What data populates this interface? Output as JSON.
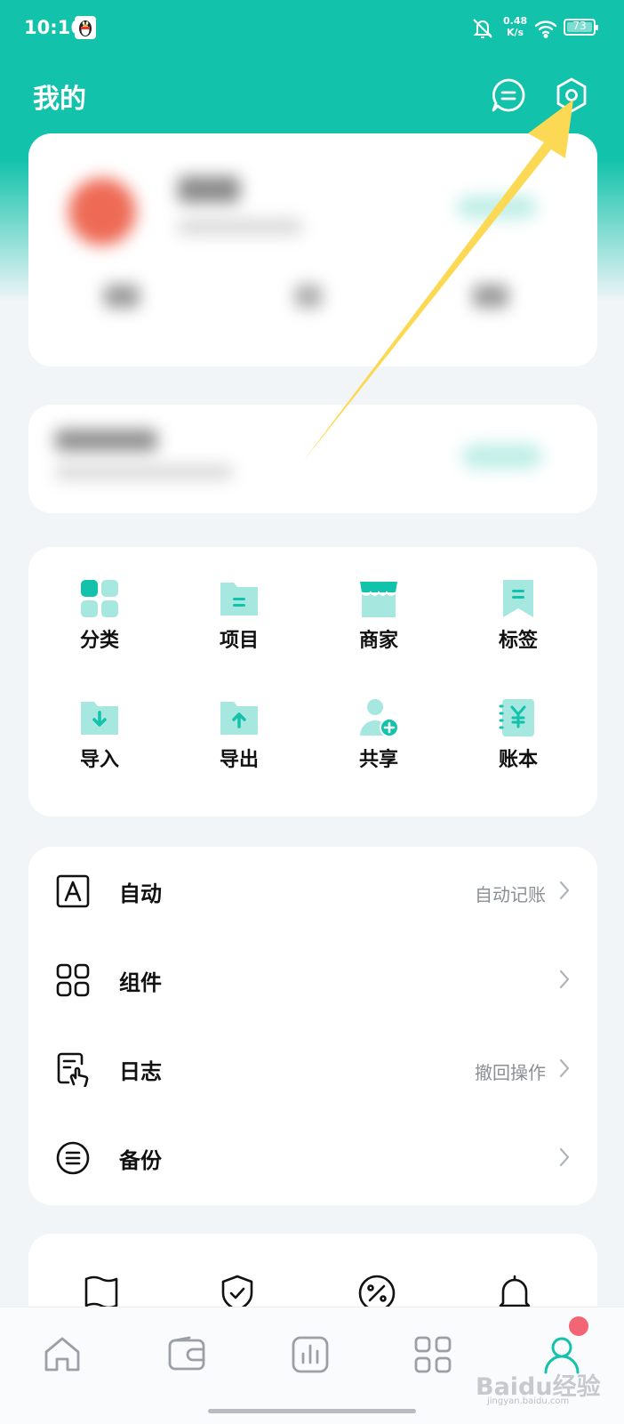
{
  "status_bar": {
    "time": "10:16",
    "net_speed_value": "0.48",
    "net_speed_unit": "K/s",
    "battery": "73"
  },
  "header": {
    "title": "我的"
  },
  "grid": [
    {
      "label": "分类",
      "icon": "category-icon"
    },
    {
      "label": "项目",
      "icon": "project-folder-icon"
    },
    {
      "label": "商家",
      "icon": "store-icon"
    },
    {
      "label": "标签",
      "icon": "bookmark-tag-icon"
    },
    {
      "label": "导入",
      "icon": "import-folder-icon"
    },
    {
      "label": "导出",
      "icon": "export-folder-icon"
    },
    {
      "label": "共享",
      "icon": "share-user-icon"
    },
    {
      "label": "账本",
      "icon": "ledger-book-icon"
    }
  ],
  "menu": [
    {
      "label": "自动",
      "value": "自动记账",
      "icon": "auto-a-icon"
    },
    {
      "label": "组件",
      "value": "",
      "icon": "widgets-grid-icon"
    },
    {
      "label": "日志",
      "value": "撤回操作",
      "icon": "log-touch-icon"
    },
    {
      "label": "备份",
      "value": "",
      "icon": "backup-icon"
    }
  ],
  "watermark": {
    "main": "Baidu经验",
    "sub": "jingyan.baidu.com"
  },
  "colors": {
    "accent": "#13c2ab",
    "accent_light": "#a6e7df",
    "badge": "#f26575",
    "annotation_arrow": "#fcd955"
  }
}
